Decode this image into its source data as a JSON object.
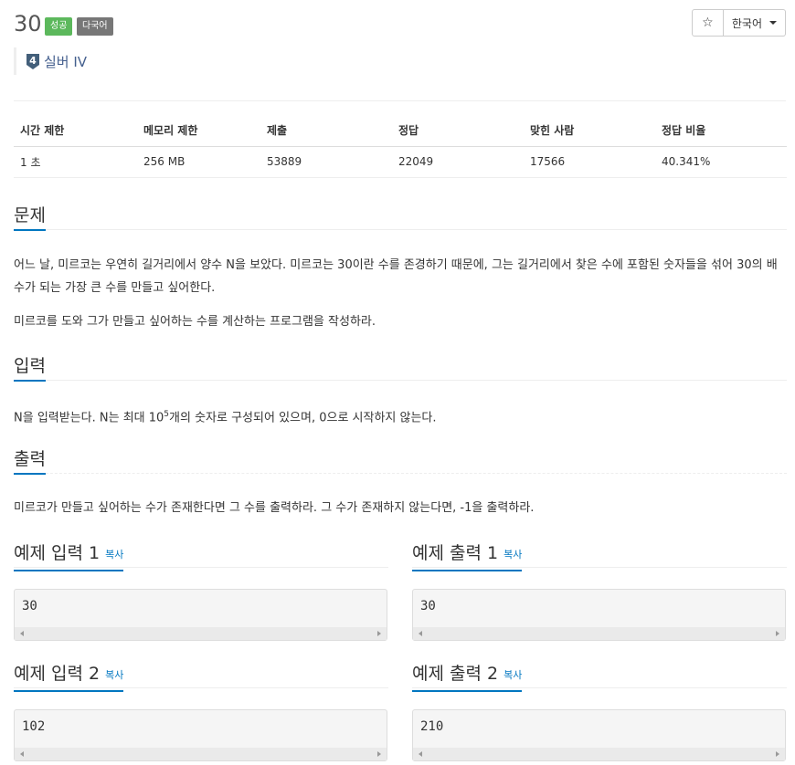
{
  "problem": {
    "id": "30",
    "badge_success": "성공",
    "badge_multilang": "다국어",
    "tier": "실버 IV",
    "tier_num": "4"
  },
  "toolbar": {
    "star_label": "☆",
    "language": "한국어"
  },
  "info_table": {
    "headers": [
      "시간 제한",
      "메모리 제한",
      "제출",
      "정답",
      "맞힌 사람",
      "정답 비율"
    ],
    "row": [
      "1 초",
      "256 MB",
      "53889",
      "22049",
      "17566",
      "40.341%"
    ]
  },
  "sections": {
    "problem_title": "문제",
    "problem_p1": "어느 날, 미르코는 우연히 길거리에서 양수 N을 보았다. 미르코는 30이란 수를 존경하기 때문에, 그는 길거리에서 찾은 수에 포함된 숫자들을 섞어 30의 배수가 되는 가장 큰 수를 만들고 싶어한다.",
    "problem_p2": "미르코를 도와 그가 만들고 싶어하는 수를 계산하는 프로그램을 작성하라.",
    "input_title": "입력",
    "input_pre": "N을 입력받는다. N는 최대 10",
    "input_sup": "5",
    "input_post": "개의 숫자로 구성되어 있으며, 0으로 시작하지 않는다.",
    "output_title": "출력",
    "output_p": "미르코가 만들고 싶어하는 수가 존재한다면 그 수를 출력하라. 그 수가 존재하지 않는다면, -1을 출력하라."
  },
  "samples": {
    "copy": "복사",
    "in1_title": "예제 입력 1",
    "out1_title": "예제 출력 1",
    "in1": "30",
    "out1": "30",
    "in2_title": "예제 입력 2",
    "out2_title": "예제 출력 2",
    "in2": "102",
    "out2": "210"
  }
}
